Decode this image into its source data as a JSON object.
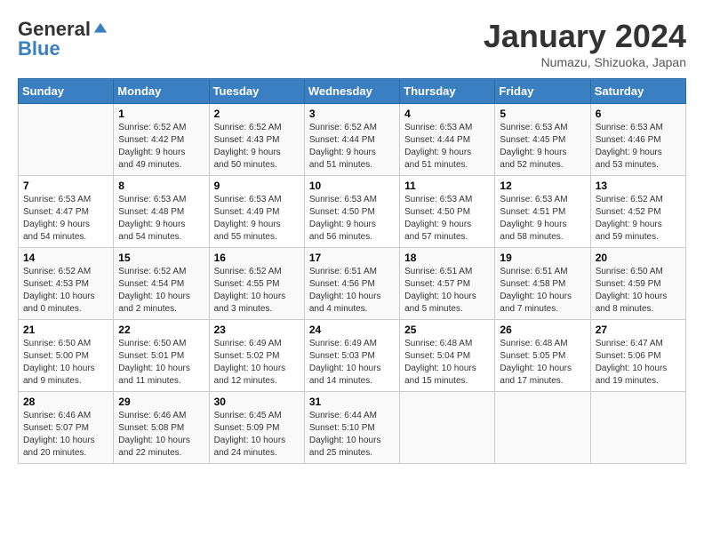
{
  "logo": {
    "general": "General",
    "blue": "Blue"
  },
  "title": "January 2024",
  "location": "Numazu, Shizuoka, Japan",
  "days_header": [
    "Sunday",
    "Monday",
    "Tuesday",
    "Wednesday",
    "Thursday",
    "Friday",
    "Saturday"
  ],
  "weeks": [
    [
      {
        "day": "",
        "info": ""
      },
      {
        "day": "1",
        "info": "Sunrise: 6:52 AM\nSunset: 4:42 PM\nDaylight: 9 hours\nand 49 minutes."
      },
      {
        "day": "2",
        "info": "Sunrise: 6:52 AM\nSunset: 4:43 PM\nDaylight: 9 hours\nand 50 minutes."
      },
      {
        "day": "3",
        "info": "Sunrise: 6:52 AM\nSunset: 4:44 PM\nDaylight: 9 hours\nand 51 minutes."
      },
      {
        "day": "4",
        "info": "Sunrise: 6:53 AM\nSunset: 4:44 PM\nDaylight: 9 hours\nand 51 minutes."
      },
      {
        "day": "5",
        "info": "Sunrise: 6:53 AM\nSunset: 4:45 PM\nDaylight: 9 hours\nand 52 minutes."
      },
      {
        "day": "6",
        "info": "Sunrise: 6:53 AM\nSunset: 4:46 PM\nDaylight: 9 hours\nand 53 minutes."
      }
    ],
    [
      {
        "day": "7",
        "info": "Sunrise: 6:53 AM\nSunset: 4:47 PM\nDaylight: 9 hours\nand 54 minutes."
      },
      {
        "day": "8",
        "info": "Sunrise: 6:53 AM\nSunset: 4:48 PM\nDaylight: 9 hours\nand 54 minutes."
      },
      {
        "day": "9",
        "info": "Sunrise: 6:53 AM\nSunset: 4:49 PM\nDaylight: 9 hours\nand 55 minutes."
      },
      {
        "day": "10",
        "info": "Sunrise: 6:53 AM\nSunset: 4:50 PM\nDaylight: 9 hours\nand 56 minutes."
      },
      {
        "day": "11",
        "info": "Sunrise: 6:53 AM\nSunset: 4:50 PM\nDaylight: 9 hours\nand 57 minutes."
      },
      {
        "day": "12",
        "info": "Sunrise: 6:53 AM\nSunset: 4:51 PM\nDaylight: 9 hours\nand 58 minutes."
      },
      {
        "day": "13",
        "info": "Sunrise: 6:52 AM\nSunset: 4:52 PM\nDaylight: 9 hours\nand 59 minutes."
      }
    ],
    [
      {
        "day": "14",
        "info": "Sunrise: 6:52 AM\nSunset: 4:53 PM\nDaylight: 10 hours\nand 0 minutes."
      },
      {
        "day": "15",
        "info": "Sunrise: 6:52 AM\nSunset: 4:54 PM\nDaylight: 10 hours\nand 2 minutes."
      },
      {
        "day": "16",
        "info": "Sunrise: 6:52 AM\nSunset: 4:55 PM\nDaylight: 10 hours\nand 3 minutes."
      },
      {
        "day": "17",
        "info": "Sunrise: 6:51 AM\nSunset: 4:56 PM\nDaylight: 10 hours\nand 4 minutes."
      },
      {
        "day": "18",
        "info": "Sunrise: 6:51 AM\nSunset: 4:57 PM\nDaylight: 10 hours\nand 5 minutes."
      },
      {
        "day": "19",
        "info": "Sunrise: 6:51 AM\nSunset: 4:58 PM\nDaylight: 10 hours\nand 7 minutes."
      },
      {
        "day": "20",
        "info": "Sunrise: 6:50 AM\nSunset: 4:59 PM\nDaylight: 10 hours\nand 8 minutes."
      }
    ],
    [
      {
        "day": "21",
        "info": "Sunrise: 6:50 AM\nSunset: 5:00 PM\nDaylight: 10 hours\nand 9 minutes."
      },
      {
        "day": "22",
        "info": "Sunrise: 6:50 AM\nSunset: 5:01 PM\nDaylight: 10 hours\nand 11 minutes."
      },
      {
        "day": "23",
        "info": "Sunrise: 6:49 AM\nSunset: 5:02 PM\nDaylight: 10 hours\nand 12 minutes."
      },
      {
        "day": "24",
        "info": "Sunrise: 6:49 AM\nSunset: 5:03 PM\nDaylight: 10 hours\nand 14 minutes."
      },
      {
        "day": "25",
        "info": "Sunrise: 6:48 AM\nSunset: 5:04 PM\nDaylight: 10 hours\nand 15 minutes."
      },
      {
        "day": "26",
        "info": "Sunrise: 6:48 AM\nSunset: 5:05 PM\nDaylight: 10 hours\nand 17 minutes."
      },
      {
        "day": "27",
        "info": "Sunrise: 6:47 AM\nSunset: 5:06 PM\nDaylight: 10 hours\nand 19 minutes."
      }
    ],
    [
      {
        "day": "28",
        "info": "Sunrise: 6:46 AM\nSunset: 5:07 PM\nDaylight: 10 hours\nand 20 minutes."
      },
      {
        "day": "29",
        "info": "Sunrise: 6:46 AM\nSunset: 5:08 PM\nDaylight: 10 hours\nand 22 minutes."
      },
      {
        "day": "30",
        "info": "Sunrise: 6:45 AM\nSunset: 5:09 PM\nDaylight: 10 hours\nand 24 minutes."
      },
      {
        "day": "31",
        "info": "Sunrise: 6:44 AM\nSunset: 5:10 PM\nDaylight: 10 hours\nand 25 minutes."
      },
      {
        "day": "",
        "info": ""
      },
      {
        "day": "",
        "info": ""
      },
      {
        "day": "",
        "info": ""
      }
    ]
  ]
}
